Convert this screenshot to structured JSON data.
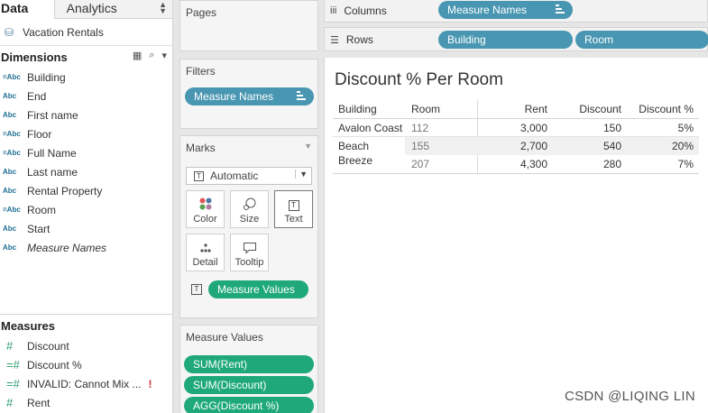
{
  "tabs": {
    "data": "Data",
    "analytics": "Analytics"
  },
  "datasource": "Vacation Rentals",
  "dimensions": {
    "title": "Dimensions",
    "fields": [
      {
        "type": "=Abc",
        "label": "Building"
      },
      {
        "type": "Abc",
        "label": "End"
      },
      {
        "type": "Abc",
        "label": "First name"
      },
      {
        "type": "=Abc",
        "label": "Floor"
      },
      {
        "type": "=Abc",
        "label": "Full Name"
      },
      {
        "type": "Abc",
        "label": "Last name"
      },
      {
        "type": "Abc",
        "label": "Rental Property"
      },
      {
        "type": "=Abc",
        "label": "Room"
      },
      {
        "type": "Abc",
        "label": "Start"
      },
      {
        "type": "Abc",
        "label": "Measure Names"
      }
    ]
  },
  "measures": {
    "title": "Measures",
    "fields": [
      {
        "type": "#",
        "label": "Discount"
      },
      {
        "type": "=#",
        "label": "Discount %"
      },
      {
        "type": "=#",
        "label": "INVALID: Cannot Mix ...",
        "warning": "!"
      },
      {
        "type": "#",
        "label": "Rent"
      }
    ]
  },
  "pages": {
    "title": "Pages"
  },
  "filters": {
    "title": "Filters",
    "pill": "Measure Names"
  },
  "marks": {
    "title": "Marks",
    "type_select": "Automatic",
    "buttons": {
      "color": "Color",
      "size": "Size",
      "text": "Text",
      "detail": "Detail",
      "tooltip": "Tooltip"
    },
    "text_pill": "Measure Values"
  },
  "measure_values": {
    "title": "Measure Values",
    "pills": [
      "SUM(Rent)",
      "SUM(Discount)",
      "AGG(Discount %)"
    ]
  },
  "columns": {
    "label": "Columns",
    "pill": "Measure Names"
  },
  "rows": {
    "label": "Rows",
    "pills": [
      "Building",
      "Room"
    ]
  },
  "view": {
    "title": "Discount % Per Room",
    "headers": {
      "building": "Building",
      "room": "Room",
      "rent": "Rent",
      "discount": "Discount",
      "pct": "Discount %"
    },
    "rows": [
      {
        "building": "Avalon Coast",
        "room": "112",
        "rent": "3,000",
        "discount": "150",
        "pct": "5%"
      },
      {
        "building": "Beach Breeze",
        "room": "155",
        "rent": "2,700",
        "discount": "540",
        "pct": "20%"
      },
      {
        "building": "",
        "room": "207",
        "rent": "4,300",
        "discount": "280",
        "pct": "7%"
      }
    ]
  },
  "watermark": "CSDN @LIQING LIN",
  "colors": {
    "pill_blue": "#4996b2",
    "pill_green": "#1fa97b",
    "dimension_icon": "#1f6e94",
    "measure_icon": "#2e9e6f"
  }
}
